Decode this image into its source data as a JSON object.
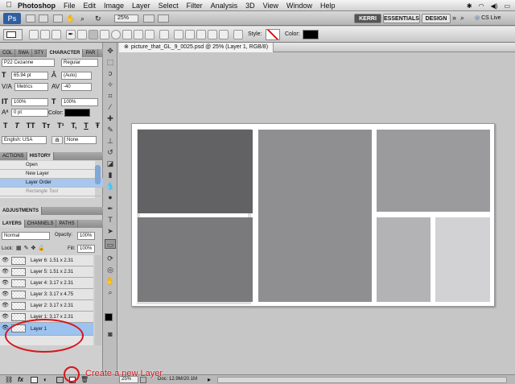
{
  "menubar": {
    "apple": "",
    "items": [
      "Photoshop",
      "File",
      "Edit",
      "Image",
      "Layer",
      "Select",
      "Filter",
      "Analysis",
      "3D",
      "View",
      "Window",
      "Help"
    ]
  },
  "appbar": {
    "ps_label": "Ps",
    "zoom": "25%",
    "workspaces": [
      "KERRI",
      "ESSENTIALS",
      "DESIGN"
    ],
    "more": "»",
    "search_icon": "search-icon",
    "cs_live": "CS Live"
  },
  "options": {
    "style_label": "Style:",
    "color_label": "Color:"
  },
  "character_panel": {
    "tabs": [
      "COL",
      "SWA",
      "STY",
      "CHARACTER",
      "PAR"
    ],
    "font_family": "P22 Cezanne",
    "font_style": "Regular",
    "size": "65.94 pt",
    "leading": "(Auto)",
    "kerning": "Metrics",
    "tracking": "-40",
    "vscale": "100%",
    "hscale": "100%",
    "baseline": "0 pt",
    "color_label": "Color:",
    "glyphs": [
      "T",
      "T",
      "TT",
      "Tт",
      "T¹",
      "T,",
      "T",
      "Ŧ"
    ],
    "language": "English: USA",
    "aa_label": "a",
    "aa": "None"
  },
  "history_panel": {
    "tabs": [
      "ACTIONS",
      "HISTORY"
    ],
    "items": [
      "Open",
      "New Layer",
      "Layer Order",
      "Rectangle Tool"
    ],
    "selected": 2
  },
  "adjustments": {
    "title": "ADJUSTMENTS"
  },
  "layers_panel": {
    "tabs": [
      "LAYERS",
      "CHANNELS",
      "PATHS"
    ],
    "blend": "Normal",
    "opacity_label": "Opacity:",
    "opacity": "100%",
    "lock_label": "Lock:",
    "fill_label": "Fill:",
    "fill": "100%",
    "layers": [
      "Layer 6: 1.51 x 2.31",
      "Layer 5: 1.51 x 2.31",
      "Layer 4: 3.17 x 2.31",
      "Layer 3: 3.17 x 4.75",
      "Layer 2: 3.17 x 2.31",
      "Layer 1: 3.17 x 2.31",
      "Layer 1"
    ],
    "selected": 6
  },
  "document": {
    "tab_title": "picture_that_GL_9_0025.psd @ 25% (Layer 1, RGB/8)",
    "close_icon": "close-icon"
  },
  "statusbar": {
    "zoom": "25%",
    "doc": "Doc: 12.9M/20.1M"
  },
  "annotation": {
    "text": "Create a new Layer",
    "color": "#d8141b"
  }
}
